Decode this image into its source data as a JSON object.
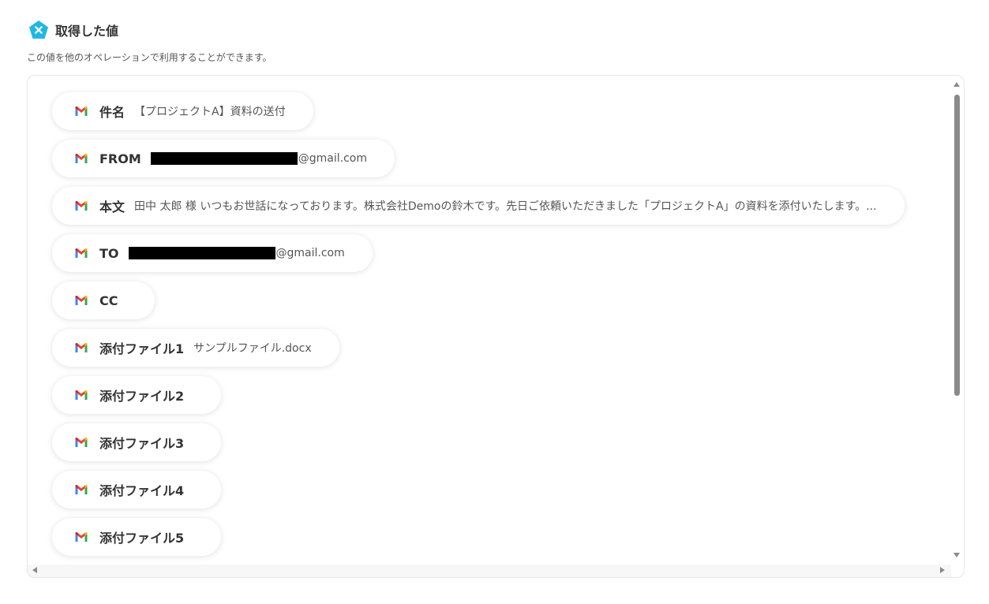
{
  "header": {
    "title": "取得した値",
    "subtitle": "この値を他のオペレーションで利用することができます。",
    "icon": "yoom-x-icon",
    "icon_color": "#1fb8e6"
  },
  "colors": {
    "gmail_red": "#EA4335",
    "gmail_blue": "#4285F4",
    "gmail_green": "#34A853",
    "gmail_yellow": "#FBBC04",
    "gmail_darkred": "#C5221F"
  },
  "fields": [
    {
      "label": "件名",
      "value": "【プロジェクトA】資料の送付"
    },
    {
      "label": "FROM",
      "value": "@gmail.com"
    },
    {
      "label": "本文",
      "value": "田中 太郎 様 いつもお世話になっております。株式会社Demoの鈴木です。先日ご依頼いただきました「プロジェクトA」の資料を添付いたします。..."
    },
    {
      "label": "TO",
      "value": "@gmail.com"
    },
    {
      "label": "CC",
      "value": ""
    },
    {
      "label": "添付ファイル1",
      "value": "サンプルファイル.docx"
    },
    {
      "label": "添付ファイル2",
      "value": ""
    },
    {
      "label": "添付ファイル3",
      "value": ""
    },
    {
      "label": "添付ファイル4",
      "value": ""
    },
    {
      "label": "添付ファイル5",
      "value": ""
    }
  ]
}
